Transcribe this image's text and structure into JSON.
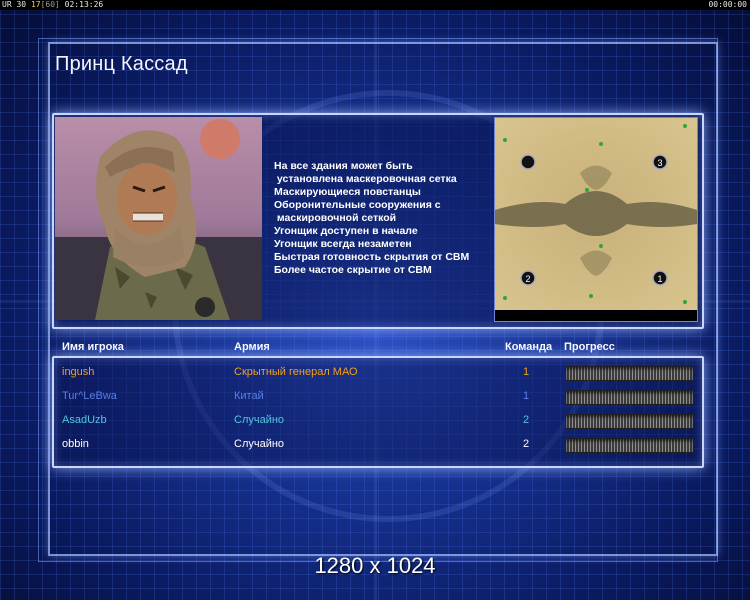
{
  "status_bar": {
    "left_prefix": "UR",
    "fps": "30",
    "frame": "17",
    "frame_target": "[60]",
    "clock": "02:13:26",
    "right_clock": "00:00:00"
  },
  "title": "Принц Кассад",
  "features": [
    "На все здания может быть",
    " установлена маскеровочная сетка",
    "Маскирующиеся повстанцы",
    "Оборонительные сооружения с",
    " маскировочной сеткой",
    "Угонщик доступен в начале",
    "Угонщик всегда незаметен",
    "Быстрая готовность скрытия от СВМ",
    "Более частое скрытие от СВМ"
  ],
  "minimap": {
    "start_positions": [
      "1",
      "2",
      "3"
    ]
  },
  "columns": {
    "player": "Имя игрока",
    "army": "Армия",
    "team": "Команда",
    "progress": "Прогресс"
  },
  "players": [
    {
      "name": "ingush",
      "army": "Скрытный генерал МАО",
      "team": "1",
      "color": "#f0a020",
      "progress": 1.0
    },
    {
      "name": "Tur^LeBwa",
      "army": "Китай",
      "team": "1",
      "color": "#5b7fe6",
      "progress": 1.0
    },
    {
      "name": "AsadUzb",
      "army": "Случайно",
      "team": "2",
      "color": "#4fc8dc",
      "progress": 1.0
    },
    {
      "name": "obbin",
      "army": "Случайно",
      "team": "2",
      "color": "#ffffff",
      "progress": 1.0
    }
  ],
  "resolution_text": "1280 x 1024",
  "colors": {
    "background": "#0a1a5e",
    "panel_border": "#c9d6ff"
  }
}
